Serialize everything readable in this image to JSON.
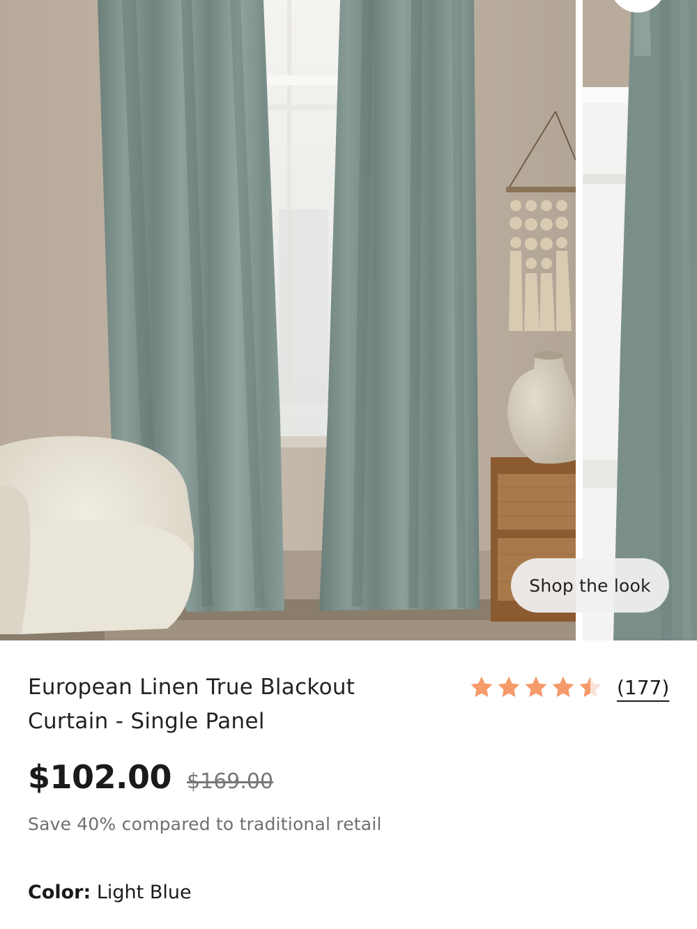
{
  "gallery": {
    "shop_the_look_label": "Shop the look"
  },
  "product": {
    "title_line1": "European Linen True Blackout",
    "title_line2": "Curtain - Single Panel",
    "rating": 4.5,
    "review_count": "(177)",
    "price": "$102.00",
    "original_price": "$169.00",
    "savings_text": "Save 40% compared to traditional retail",
    "color_label": "Color:",
    "color_value": "Light Blue"
  },
  "colors": {
    "star": "#F59A6A",
    "curtain": "#7D918C",
    "wall": "#B9AC9F"
  },
  "icons": {
    "star": "star-icon",
    "half_star": "half-star-icon"
  }
}
